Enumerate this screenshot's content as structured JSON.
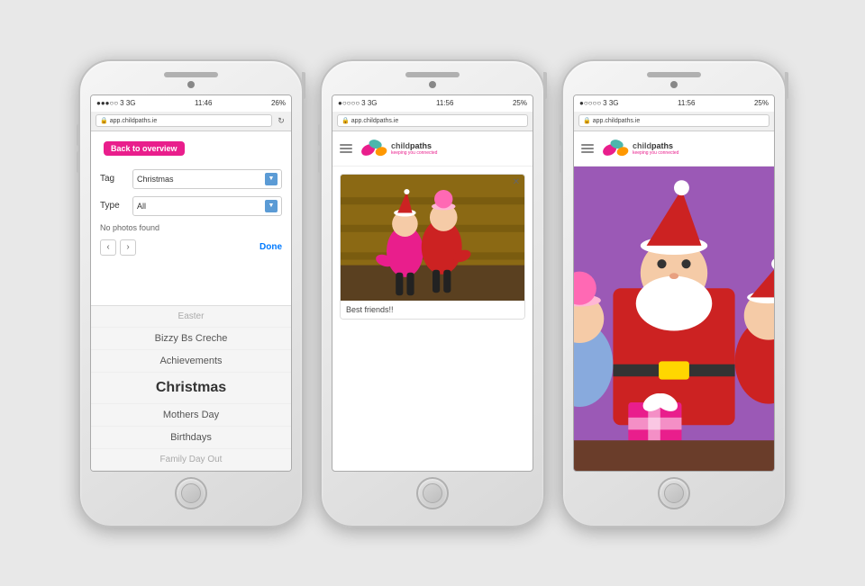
{
  "phones": [
    {
      "id": "phone1",
      "status": {
        "dots": "●●●○○",
        "network": "3  3G",
        "time": "11:46",
        "battery_icon": "🔋",
        "battery_pct": "26%"
      },
      "browser": {
        "url": "app.childpaths.ie",
        "lock": "🔒"
      },
      "back_btn": "Back to overview",
      "filter": {
        "tag_label": "Tag",
        "tag_value": "Christmas",
        "type_label": "Type",
        "type_value": "All",
        "no_photos": "No photos found",
        "done": "Done"
      },
      "dropdown_items": [
        {
          "label": "Easter",
          "state": "faded"
        },
        {
          "label": "Bizzy Bs Creche",
          "state": "normal"
        },
        {
          "label": "Achievements",
          "state": "normal"
        },
        {
          "label": "Christmas",
          "state": "selected"
        },
        {
          "label": "Mothers Day",
          "state": "normal"
        },
        {
          "label": "Birthdays",
          "state": "normal"
        },
        {
          "label": "Family Day Out",
          "state": "faded"
        }
      ]
    },
    {
      "id": "phone2",
      "status": {
        "dots": "●○○○○",
        "network": "3  3G",
        "time": "11:56",
        "battery_icon": "🔋",
        "battery_pct": "25%"
      },
      "browser": {
        "url": "app.childpaths.ie",
        "lock": "🔒"
      },
      "logo": {
        "child": "child",
        "paths": "paths",
        "tagline": "keeping you connected"
      },
      "photo": {
        "caption": "Best friends!!"
      }
    },
    {
      "id": "phone3",
      "status": {
        "dots": "●○○○○",
        "network": "3  3G",
        "time": "11:56",
        "battery_icon": "🔋",
        "battery_pct": "25%"
      },
      "browser": {
        "url": "app.childpaths.ie",
        "lock": "🔒"
      },
      "logo": {
        "child": "child",
        "paths": "paths",
        "tagline": "keeping you connected"
      }
    }
  ]
}
